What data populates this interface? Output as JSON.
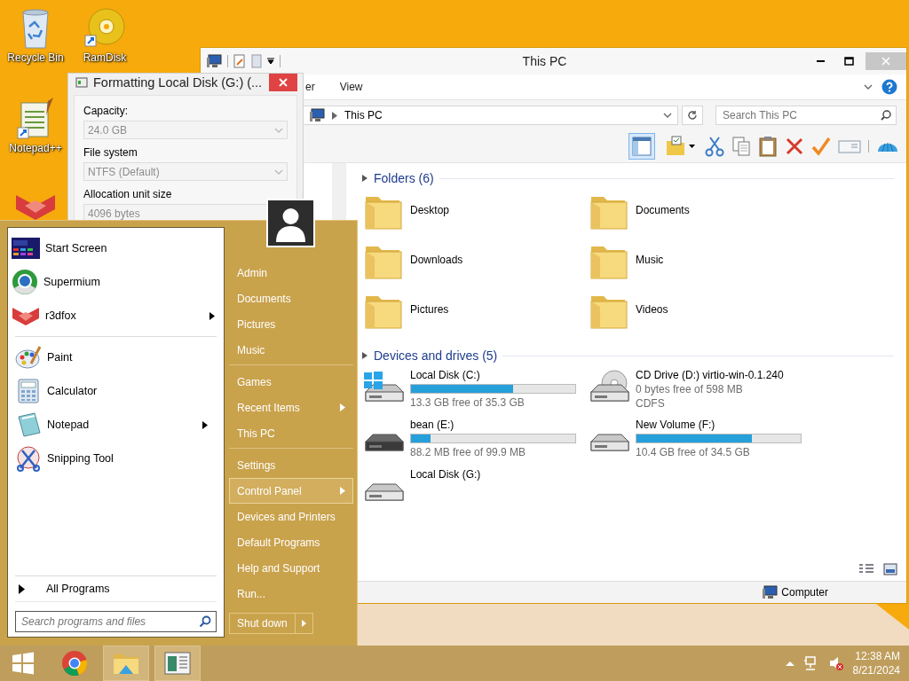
{
  "desktop_icons": [
    {
      "kind": "recycle_bin",
      "label": "Recycle Bin"
    },
    {
      "kind": "disc",
      "label": "RamDisk"
    },
    {
      "kind": "notepad_plus",
      "label": "Notepad++"
    },
    {
      "kind": "fox"
    }
  ],
  "explorer": {
    "title": "This PC",
    "ribbon_tabs": [
      "er",
      "View"
    ],
    "address": "This PC",
    "search": {
      "placeholder": "Search This PC"
    },
    "groups": [
      {
        "title": "Folders (6)",
        "items": [
          {
            "kind": "folder",
            "name": "Desktop"
          },
          {
            "kind": "folder",
            "name": "Documents"
          },
          {
            "kind": "folder",
            "name": "Downloads"
          },
          {
            "kind": "folder",
            "name": "Music"
          },
          {
            "kind": "folder",
            "name": "Pictures"
          },
          {
            "kind": "folder",
            "name": "Videos"
          }
        ]
      },
      {
        "title": "Devices and drives (5)",
        "items": [
          {
            "kind": "system_drive",
            "name": "Local Disk (C:)",
            "level": 0.62,
            "details": [
              "13.3 GB free of 35.3 GB"
            ]
          },
          {
            "kind": "cd_drive",
            "name": "CD Drive (D:) virtio-win-0.1.240",
            "details": [
              "0 bytes free of 598 MB",
              "CDFS"
            ]
          },
          {
            "kind": "usb_drive",
            "name": "bean (E:)",
            "level": 0.12,
            "details": [
              "88.2 MB free of 99.9 MB"
            ]
          },
          {
            "kind": "drive",
            "name": "New Volume (F:)",
            "level": 0.7,
            "details": [
              "10.4 GB free of 34.5 GB"
            ]
          },
          {
            "kind": "drive",
            "name": "Local Disk (G:)"
          }
        ]
      }
    ],
    "status_bar": "Computer"
  },
  "format_dialog": {
    "title": "Formatting Local Disk (G:) (...",
    "fields": [
      {
        "label": "Capacity:",
        "value": "24.0 GB",
        "disabled": true
      },
      {
        "label": "File system",
        "value": "NTFS (Default)",
        "disabled": true
      },
      {
        "label": "Allocation unit size",
        "value": "4096 bytes",
        "disabled": true
      }
    ]
  },
  "start_menu": {
    "programs": [
      {
        "items": [
          {
            "kind": "start_screen",
            "label": "Start Screen",
            "submenu": false
          },
          {
            "kind": "browser",
            "label": "Supermium",
            "submenu": false
          },
          {
            "kind": "fox",
            "label": "r3dfox",
            "submenu": true
          }
        ]
      },
      {
        "items": [
          {
            "kind": "paint",
            "label": "Paint",
            "submenu": false
          },
          {
            "kind": "calculator",
            "label": "Calculator",
            "submenu": false
          },
          {
            "kind": "notepad",
            "label": "Notepad",
            "submenu": true
          },
          {
            "kind": "scissors",
            "label": "Snipping Tool",
            "submenu": false
          }
        ]
      }
    ],
    "all_programs": "All Programs",
    "search": {
      "placeholder": "Search programs and files"
    },
    "places": [
      {
        "items": [
          {
            "label": "Admin",
            "submenu": false,
            "selected": false
          },
          {
            "label": "Documents",
            "submenu": false,
            "selected": false
          },
          {
            "label": "Pictures",
            "submenu": false,
            "selected": false
          },
          {
            "label": "Music",
            "submenu": false,
            "selected": false
          }
        ]
      },
      {
        "items": [
          {
            "label": "Games",
            "submenu": false,
            "selected": false
          },
          {
            "label": "Recent Items",
            "submenu": true,
            "selected": false
          },
          {
            "label": "This PC",
            "submenu": false,
            "selected": false
          }
        ]
      },
      {
        "items": [
          {
            "label": "Settings",
            "submenu": false,
            "selected": false
          },
          {
            "label": "Control Panel",
            "submenu": true,
            "selected": true
          },
          {
            "label": "Devices and Printers",
            "submenu": false,
            "selected": false
          },
          {
            "label": "Default Programs",
            "submenu": false,
            "selected": false
          },
          {
            "label": "Help and Support",
            "submenu": false,
            "selected": false
          },
          {
            "label": "Run...",
            "submenu": false,
            "selected": false
          }
        ]
      }
    ],
    "shutdown": "Shut down"
  },
  "taskbar": {
    "apps": [
      {
        "kind": "start",
        "active": false
      },
      {
        "kind": "chrome",
        "active": false
      },
      {
        "kind": "explorer",
        "active": true
      },
      {
        "kind": "app",
        "active": true
      }
    ],
    "time": "12:38 AM",
    "date": "8/21/2024"
  }
}
